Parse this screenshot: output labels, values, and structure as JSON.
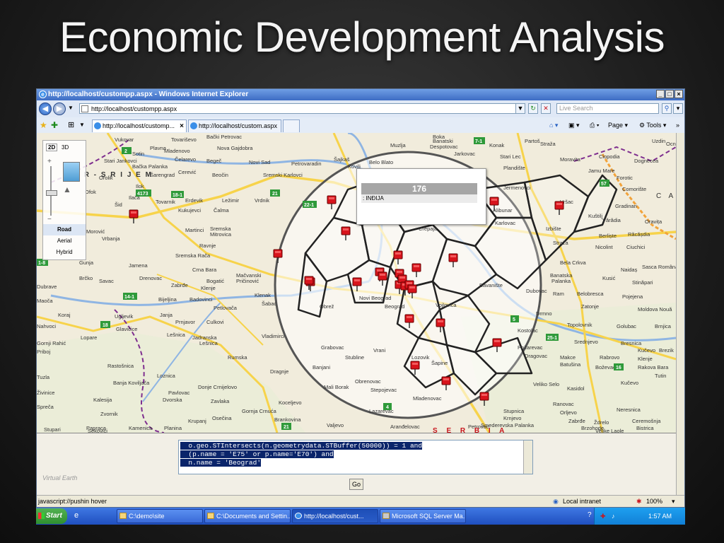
{
  "slide": {
    "title": "Economic Development Analysis"
  },
  "window": {
    "title": "http://localhost/custompp.aspx - Windows Internet Explorer",
    "url": "http://localhost/custompp.aspx",
    "search_placeholder": "Live Search"
  },
  "tabs": [
    {
      "label": "http://localhost/customp...",
      "active": true
    },
    {
      "label": "http://localhost/custom.aspx",
      "active": false
    }
  ],
  "command_bar": {
    "page": "Page",
    "tools": "Tools"
  },
  "map": {
    "view_2d": "2D",
    "view_3d": "3D",
    "modes": [
      "Road",
      "Aerial",
      "Hybrid"
    ],
    "brand": "Virtual Earth",
    "popup": {
      "value": "176",
      "label": ": INĐIJA"
    },
    "places": [
      {
        "name": "Vukovar"
      },
      {
        "name": "Tovariševo"
      },
      {
        "name": "Bački Petrovac"
      },
      {
        "name": "Zrenjanin"
      },
      {
        "name": "Boka"
      },
      {
        "name": "Partoš"
      },
      {
        "name": "Plavna"
      },
      {
        "name": "Nova Gajdobra"
      },
      {
        "name": "Banatski Despotovac"
      },
      {
        "name": "Konak"
      },
      {
        "name": "Straža"
      },
      {
        "name": "Uzdin"
      },
      {
        "name": "Sotin"
      },
      {
        "name": "Mladenovo"
      },
      {
        "name": "Bela"
      },
      {
        "name": "Muzlja"
      },
      {
        "name": "Belo Blato"
      },
      {
        "name": "Jarkovac"
      },
      {
        "name": "Stari Lec"
      },
      {
        "name": "Moravita"
      },
      {
        "name": "Ciopodia"
      },
      {
        "name": "Dognecea"
      },
      {
        "name": "Ocna"
      },
      {
        "name": "Stari Jankovci"
      },
      {
        "name": "Bačka Palanka"
      },
      {
        "name": "Čelarevo"
      },
      {
        "name": "Begeč"
      },
      {
        "name": "Novi Sad"
      },
      {
        "name": "Petrovaradin"
      },
      {
        "name": "Šajkaš"
      },
      {
        "name": "Bega"
      },
      {
        "name": "Plandište"
      },
      {
        "name": "Jamu Mare"
      },
      {
        "name": "Forotic"
      },
      {
        "name": "Sarengrad"
      },
      {
        "name": "Ilok"
      },
      {
        "name": "Cerević"
      },
      {
        "name": "Beočin"
      },
      {
        "name": "Sremski Karlovci"
      },
      {
        "name": "Kovilj"
      },
      {
        "name": "Jermenovci"
      },
      {
        "name": "Comorište"
      },
      {
        "name": "Orolik"
      },
      {
        "name": "Ilača"
      },
      {
        "name": "Tovarnik"
      },
      {
        "name": "Erdevik"
      },
      {
        "name": "Ležimir"
      },
      {
        "name": "Vrdnik"
      },
      {
        "name": "Alibunar"
      },
      {
        "name": "Vršac"
      },
      {
        "name": "Mare"
      },
      {
        "name": "Gradinari"
      },
      {
        "name": "Ofok"
      },
      {
        "name": "Šid"
      },
      {
        "name": "Kukujevci"
      },
      {
        "name": "Čalma"
      },
      {
        "name": "Vrbas"
      },
      {
        "name": "Kuštilj"
      },
      {
        "name": "Vărădia"
      },
      {
        "name": "Oravița"
      },
      {
        "name": "Morović"
      },
      {
        "name": "Martinci"
      },
      {
        "name": "Sremska Mitrovica"
      },
      {
        "name": "Crepaja"
      },
      {
        "name": "Karlovac"
      },
      {
        "name": "Izbište"
      },
      {
        "name": "Berliște"
      },
      {
        "name": "Răcășdia"
      },
      {
        "name": "Vrbanja"
      },
      {
        "name": "Ravnje"
      },
      {
        "name": "Sremska Rača"
      },
      {
        "name": "Nicolint"
      },
      {
        "name": "Ciuchici"
      },
      {
        "name": "Gunja"
      },
      {
        "name": "Jamena"
      },
      {
        "name": "Crna Bara"
      },
      {
        "name": "Bela Crkva"
      },
      {
        "name": "Naidaș"
      },
      {
        "name": "Sasca Română"
      },
      {
        "name": "Brčko"
      },
      {
        "name": "Drenovac"
      },
      {
        "name": "Bogatić"
      },
      {
        "name": "Mačvanski Pričinović"
      },
      {
        "name": "Banatska Palanka"
      },
      {
        "name": "Kusić"
      },
      {
        "name": "Stinăpari"
      },
      {
        "name": "Dubrave"
      },
      {
        "name": "Savac"
      },
      {
        "name": "Zabrđe"
      },
      {
        "name": "Klenje"
      },
      {
        "name": "Šabac"
      },
      {
        "name": "Obrež"
      },
      {
        "name": "Novi Beograd"
      },
      {
        "name": "Beograd"
      },
      {
        "name": "Vojlovica"
      },
      {
        "name": "Bavanište"
      },
      {
        "name": "Dubovac"
      },
      {
        "name": "Ram"
      },
      {
        "name": "Belobresca"
      },
      {
        "name": "Pojejena"
      },
      {
        "name": "Maoča"
      },
      {
        "name": "Bijeljina"
      },
      {
        "name": "Badovinci"
      },
      {
        "name": "Petlovača"
      },
      {
        "name": "Klenak"
      },
      {
        "name": "Drmno"
      },
      {
        "name": "Zatonje"
      },
      {
        "name": "Moldova Nouă"
      },
      {
        "name": "Koraj"
      },
      {
        "name": "Glavičice"
      },
      {
        "name": "Ugljevik"
      },
      {
        "name": "Janja"
      },
      {
        "name": "Prnjavor"
      },
      {
        "name": "Culkovi"
      },
      {
        "name": "Vladimirci"
      },
      {
        "name": "Topolovnik"
      },
      {
        "name": "Golubac"
      },
      {
        "name": "Brnjica"
      },
      {
        "name": "Koronja"
      },
      {
        "name": "Nahvoci"
      },
      {
        "name": "Lopare"
      },
      {
        "name": "Lešnica"
      },
      {
        "name": "Jadranska Lešnica"
      },
      {
        "name": "Kostolac"
      },
      {
        "name": "Požarevac"
      },
      {
        "name": "Dragovac"
      },
      {
        "name": "Srednjevo"
      },
      {
        "name": "Bresnica"
      },
      {
        "name": "Kučevo"
      },
      {
        "name": "Brezik"
      },
      {
        "name": "Gornji Rahić"
      },
      {
        "name": "Priboj"
      },
      {
        "name": "Zvornik"
      },
      {
        "name": "Rumska"
      },
      {
        "name": "Grabovac"
      },
      {
        "name": "Stubline"
      },
      {
        "name": "Vrani"
      },
      {
        "name": "Lozovik"
      },
      {
        "name": "Šapine"
      },
      {
        "name": "Makce"
      },
      {
        "name": "Rabrovo"
      },
      {
        "name": "Klenje"
      },
      {
        "name": "Tuzla"
      },
      {
        "name": "Rastošnica"
      },
      {
        "name": "Dragnje"
      },
      {
        "name": "Banjani"
      },
      {
        "name": "Obrenovac"
      },
      {
        "name": "Batušina"
      },
      {
        "name": "Boževac"
      },
      {
        "name": "Rakova Bara"
      },
      {
        "name": "Tutin"
      },
      {
        "name": "Banja Koviljača"
      },
      {
        "name": "Loznica"
      },
      {
        "name": "Donje Crnijelovo"
      },
      {
        "name": "Mali Borak"
      },
      {
        "name": "Stepojevac"
      },
      {
        "name": "Mladenovac"
      },
      {
        "name": "Veliko Selo"
      },
      {
        "name": "Kasidol"
      },
      {
        "name": "Kučevo"
      },
      {
        "name": "Živinice"
      },
      {
        "name": "Kalesija"
      },
      {
        "name": "Pavlovac"
      },
      {
        "name": "Dvorska"
      },
      {
        "name": "Zavlaka"
      },
      {
        "name": "Koceljevo"
      },
      {
        "name": "Gornja Crnuća"
      },
      {
        "name": "Lazarevac"
      },
      {
        "name": "Smederevska Palanka"
      },
      {
        "name": "Ranovac"
      },
      {
        "name": "Orljevo"
      },
      {
        "name": "Neresnica"
      },
      {
        "name": "Spreča"
      },
      {
        "name": "Krupanj"
      },
      {
        "name": "Osečina"
      },
      {
        "name": "Brankovina"
      },
      {
        "name": "Valjevo"
      },
      {
        "name": "Aranđelovac"
      },
      {
        "name": "Krnjevo"
      },
      {
        "name": "Zabrđe"
      },
      {
        "name": "Ždrelo"
      },
      {
        "name": "Ceremošnja"
      },
      {
        "name": "Papraca"
      },
      {
        "name": "Sekovici"
      },
      {
        "name": "Kamenica"
      },
      {
        "name": "Planina"
      },
      {
        "name": "Stupari"
      },
      {
        "name": "Petrovac"
      },
      {
        "name": "Brzohode"
      },
      {
        "name": "Bistrica"
      },
      {
        "name": "Velike Laole"
      },
      {
        "name": "Stupnica"
      },
      {
        "name": "C A R"
      },
      {
        "name": "S E R B I A"
      },
      {
        "name": "V A R - S R I J E M"
      }
    ],
    "road_numbers": [
      "2",
      "4173",
      "18-1",
      "1-8",
      "21",
      "14-1",
      "18",
      "7-1",
      "57",
      "25-1",
      "16",
      "4",
      "21",
      "22-1",
      "5",
      "1"
    ]
  },
  "sql": {
    "line1": "  o.geo.STIntersects(n.geometrydata.STBuffer(50000)) = 1 and",
    "line2": "  (p.name = 'E75' or p.name='E70') and",
    "line3": "  n.name = 'Beograd'"
  },
  "go_label": "Go",
  "status": {
    "left": "javascript://pushin hover",
    "zone": "Local intranet",
    "zoom": "100%"
  },
  "taskbar": {
    "start": "Start",
    "items": [
      {
        "label": "C:\\demo\\site"
      },
      {
        "label": "C:\\Documents and Settin..."
      },
      {
        "label": "http://localhost/cust..."
      },
      {
        "label": "Microsoft SQL Server Ma..."
      }
    ],
    "time": "1:57 AM"
  },
  "colors": {
    "pin": "#d8141c",
    "accent": "#316ac5",
    "map_bg": "#f3efe2",
    "road": "#f7d34b"
  }
}
